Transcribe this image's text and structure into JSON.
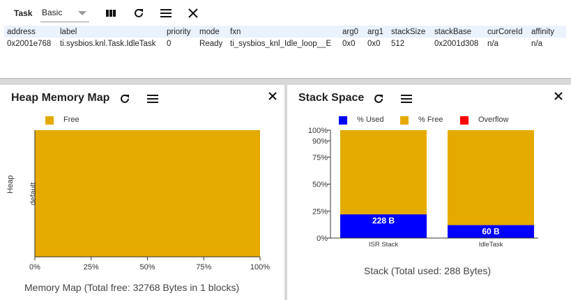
{
  "colors": {
    "free": "#e5aa00",
    "used": "#0000ff",
    "overflow": "#ff0000",
    "header_bg": "#eaf2fc"
  },
  "task": {
    "label": "Task",
    "view": "Basic",
    "icons": [
      "columns-icon",
      "refresh-icon",
      "menu-icon",
      "close-icon"
    ],
    "columns": [
      "address",
      "label",
      "priority",
      "mode",
      "fxn",
      "arg0",
      "arg1",
      "stackSize",
      "stackBase",
      "curCoreId",
      "affinity"
    ],
    "rows": [
      [
        "0x2001e768",
        "ti.sysbios.knl.Task.IdleTask",
        "0",
        "Ready",
        "ti_sysbios_knl_Idle_loop__E",
        "0x0",
        "0x0",
        "512",
        "0x2001d308",
        "n/a",
        "n/a"
      ]
    ]
  },
  "heap": {
    "title": "Heap Memory Map",
    "legend": [
      "Free"
    ],
    "y_axis_label": "Heap",
    "category": "default",
    "x_ticks": [
      "0%",
      "25%",
      "50%",
      "75%",
      "100%"
    ],
    "footer": "Memory Map (Total free: 32768 Bytes in 1 blocks)"
  },
  "stack": {
    "title": "Stack Space",
    "legend": [
      "% Used",
      "% Free",
      "Overflow"
    ],
    "y_ticks": [
      "100%",
      "90%",
      "75%",
      "50%",
      "25%",
      "0%"
    ],
    "footer": "Stack (Total used: 288 Bytes)"
  },
  "chart_data": [
    {
      "type": "bar",
      "orientation": "horizontal",
      "stacked": true,
      "categories": [
        "default"
      ],
      "series": [
        {
          "name": "Free",
          "values": [
            100
          ]
        }
      ],
      "xlim": [
        0,
        100
      ],
      "x_ticks": [
        "0%",
        "25%",
        "50%",
        "75%",
        "100%"
      ],
      "title": "Heap Memory Map",
      "ylabel": "Heap",
      "xlabel": "Memory Map (Total free: 32768 Bytes in 1 blocks)"
    },
    {
      "type": "bar",
      "stacked": true,
      "categories": [
        "ISR Stack",
        "IdleTask"
      ],
      "series": [
        {
          "name": "% Used",
          "values": [
            22,
            12
          ]
        },
        {
          "name": "% Free",
          "values": [
            78,
            88
          ]
        },
        {
          "name": "Overflow",
          "values": [
            0,
            0
          ]
        }
      ],
      "data_labels": [
        "228 B",
        "60 B"
      ],
      "ylim": [
        0,
        100
      ],
      "y_ticks": [
        "0%",
        "25%",
        "50%",
        "75%",
        "90%",
        "100%"
      ],
      "title": "Stack Space",
      "xlabel": "Stack (Total used: 288 Bytes)"
    }
  ]
}
